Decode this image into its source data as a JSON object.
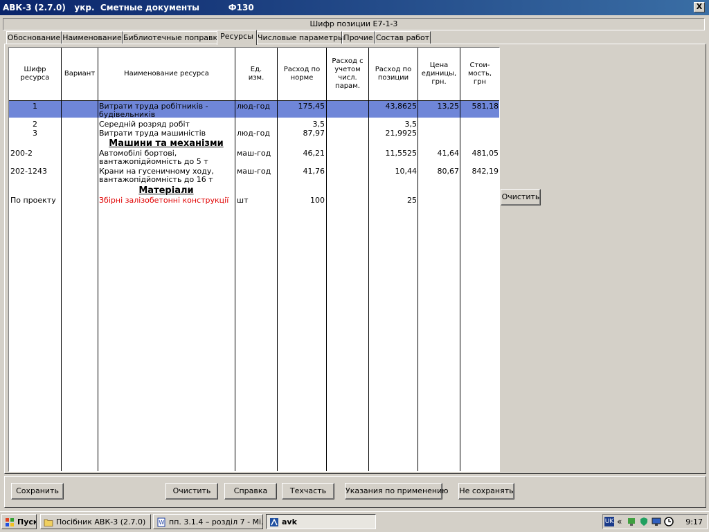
{
  "window": {
    "title": "АВК-3 (2.7.0)   укр.  Сметные документы          Ф130",
    "close_glyph": "X"
  },
  "position_code": "Шифр позиции    Е7-1-3",
  "tabs": [
    {
      "label": "Обоснование"
    },
    {
      "label": "Наименование"
    },
    {
      "label": "Библиотечные поправки"
    },
    {
      "label": "Ресурсы",
      "active": true
    },
    {
      "label": "Числовые параметры"
    },
    {
      "label": "Прочие"
    },
    {
      "label": "Состав работ"
    }
  ],
  "grid": {
    "columns": [
      "Шифр\nресурса",
      "Вариант",
      "Наименование ресурса",
      "Ед.\nизм.",
      "Расход по\nнорме",
      "Расход с\nучетом\nчисл.\nпарам.",
      "Расход по\nпозиции",
      "Цена\nединицы,\nгрн.",
      "Стои-\nмость,\nгрн"
    ],
    "rows": [
      {
        "code": "1",
        "name": "Витрати труда робітників -\nбудівельників",
        "unit": "люд-год",
        "norm": "175,45",
        "pos": "43,8625",
        "price": "13,25",
        "cost": "581,18",
        "selected": true
      },
      {
        "code": "2",
        "name": "Середній розряд робіт",
        "unit": "",
        "norm": "3,5",
        "pos": "3,5",
        "price": "",
        "cost": ""
      },
      {
        "code": "3",
        "name": "Витрати труда машиністів",
        "unit": "люд-год",
        "norm": "87,97",
        "pos": "21,9925",
        "price": "",
        "cost": ""
      },
      {
        "code": "200-2",
        "name": "Автомобілі бортові,\nвантажопідйомність до 5 т",
        "unit": "маш-год",
        "norm": "46,21",
        "pos": "11,5525",
        "price": "41,64",
        "cost": "481,05"
      },
      {
        "code": "202-1243",
        "name": "Крани на гусеничному ходу,\nвантажопідйомність до 16 т",
        "unit": "маш-год",
        "norm": "41,76",
        "pos": "10,44",
        "price": "80,67",
        "cost": "842,19"
      },
      {
        "code": "По проекту",
        "name": "Збірні залізобетонні конструкції",
        "unit": "шт",
        "norm": "100",
        "pos": "25",
        "price": "",
        "cost": ""
      }
    ],
    "sections": {
      "machines": "Машини та механізми",
      "materials": "Матеріали"
    },
    "colors": {
      "selection": "#6f86d8",
      "highlight_text": "#e00000"
    }
  },
  "side_button": "Очистить",
  "buttons": {
    "save": "Сохранить",
    "clear": "Очистить",
    "help": "Справка",
    "techpart": "Техчасть",
    "instructions": "Указания по применению",
    "dont_save": "Не сохранять"
  },
  "taskbar": {
    "start": "Пуск",
    "tasks": [
      "Посібник АВК-3 (2.7.0)",
      "пп. 3.1.4 – розділ 7 - Мі...",
      "avk"
    ],
    "lang": "UK",
    "chevron": "«",
    "clock": "9:17"
  }
}
